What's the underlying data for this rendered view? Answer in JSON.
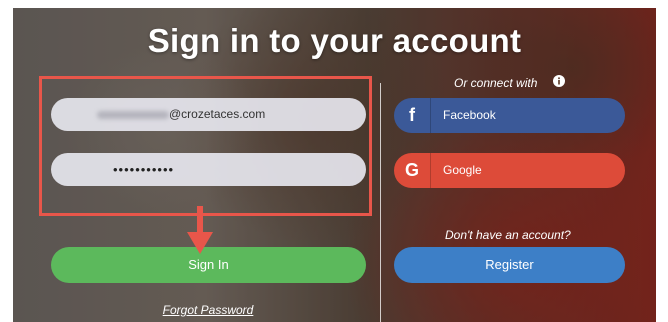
{
  "page": {
    "title": "Sign in to your account"
  },
  "login_form": {
    "email_value_visible": "@crozetaces.com",
    "password_value": "•••••••••••",
    "signin_label": "Sign In",
    "forgot_label": "Forgot Password"
  },
  "social": {
    "or_connect_label": "Or connect with",
    "facebook_label": "Facebook",
    "facebook_logo": "f",
    "google_label": "Google",
    "google_logo": "G"
  },
  "register": {
    "prompt": "Don't have an account?",
    "button_label": "Register"
  },
  "annotation": {
    "highlight_color": "#e8564a"
  },
  "colors": {
    "signin": "#5cb95c",
    "register": "#3d7fc7",
    "facebook": "#3b5998",
    "google": "#dd4b39"
  },
  "icons": [
    "info-icon",
    "facebook-icon",
    "google-icon",
    "arrow-down-icon"
  ]
}
